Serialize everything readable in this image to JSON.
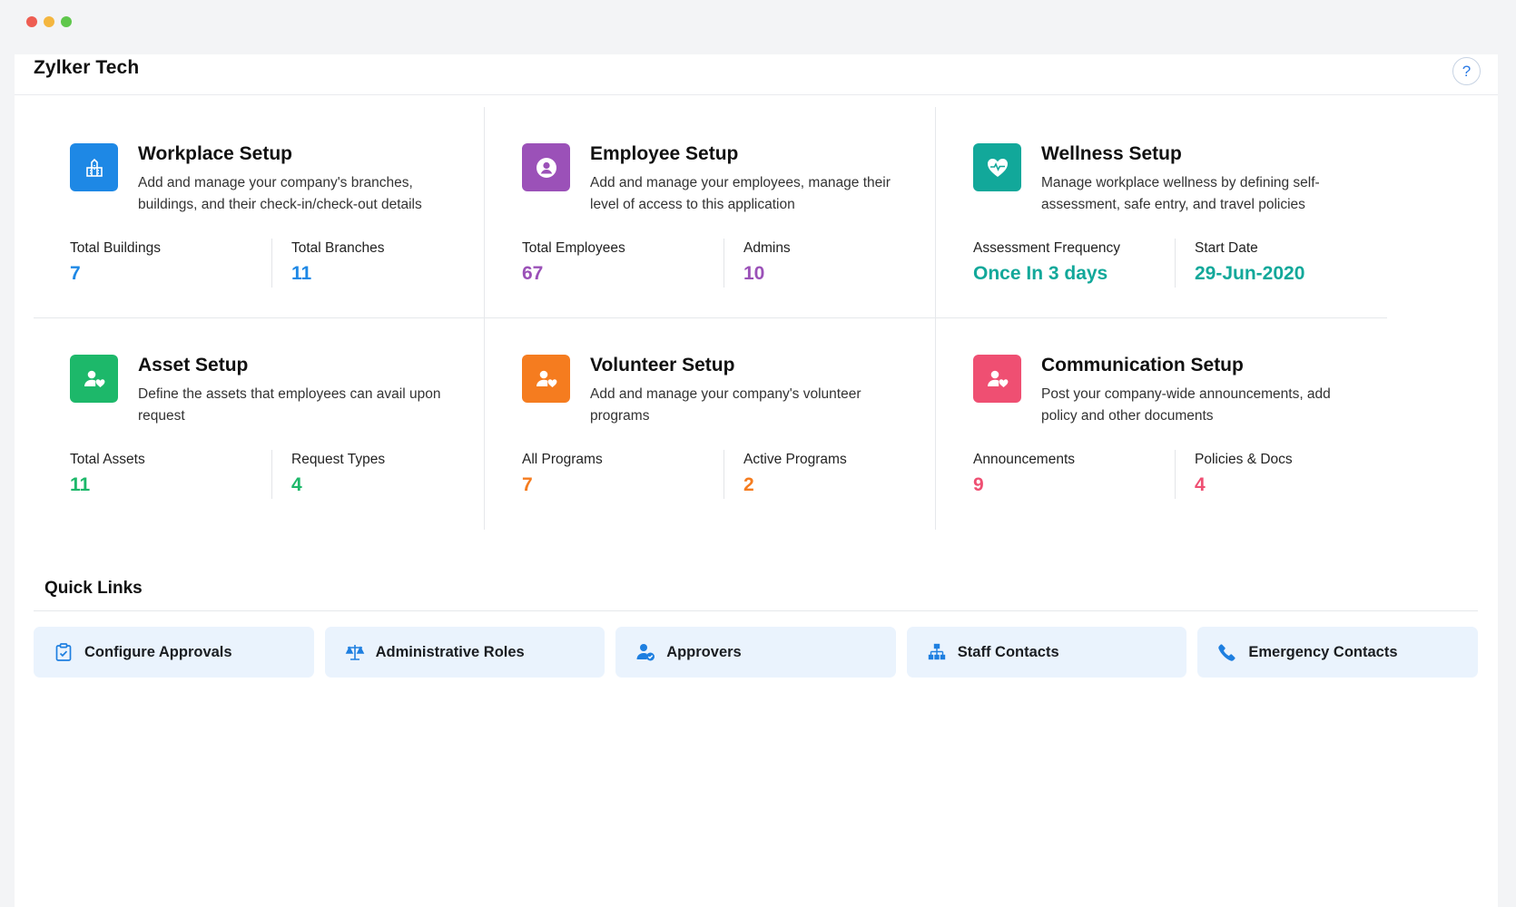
{
  "app": {
    "company_name": "Zylker Tech",
    "help_label": "?"
  },
  "cards": [
    {
      "title": "Workplace Setup",
      "description": "Add and manage your company's branches, buildings, and their check-in/check-out details",
      "icon": "building-icon",
      "color": "#1e88e5",
      "stats": [
        {
          "label": "Total Buildings",
          "value": "7"
        },
        {
          "label": "Total Branches",
          "value": "11"
        }
      ]
    },
    {
      "title": "Employee Setup",
      "description": "Add and manage your employees, manage their level of access to this application",
      "icon": "user-circle-icon",
      "color": "#9b51b8",
      "stats": [
        {
          "label": "Total Employees",
          "value": "67"
        },
        {
          "label": "Admins",
          "value": "10"
        }
      ]
    },
    {
      "title": "Wellness Setup",
      "description": "Manage workplace wellness by defining self-assessment, safe entry, and travel policies",
      "icon": "heart-pulse-icon",
      "color": "#12a89a",
      "stats": [
        {
          "label": "Assessment Frequency",
          "value": "Once In 3 days"
        },
        {
          "label": "Start Date",
          "value": "29-Jun-2020"
        }
      ]
    },
    {
      "title": "Asset Setup",
      "description": "Define the assets that employees can avail upon request",
      "icon": "user-heart-icon",
      "color": "#1db86a",
      "stats": [
        {
          "label": "Total Assets",
          "value": "11"
        },
        {
          "label": "Request Types",
          "value": "4"
        }
      ]
    },
    {
      "title": "Volunteer Setup",
      "description": "Add and manage your company's volunteer programs",
      "icon": "user-heart-icon",
      "color": "#f57c1f",
      "stats": [
        {
          "label": "All Programs",
          "value": "7"
        },
        {
          "label": "Active Programs",
          "value": "2"
        }
      ]
    },
    {
      "title": "Communication Setup",
      "description": "Post your company-wide announcements, add policy and other documents",
      "icon": "user-heart-icon",
      "color": "#ef4f72",
      "stats": [
        {
          "label": "Announcements",
          "value": "9"
        },
        {
          "label": "Policies & Docs",
          "value": "4"
        }
      ]
    }
  ],
  "quick_links": {
    "title": "Quick Links",
    "items": [
      {
        "label": "Configure Approvals",
        "icon": "clipboard-check-icon"
      },
      {
        "label": "Administrative Roles",
        "icon": "scale-icon"
      },
      {
        "label": "Approvers",
        "icon": "user-check-icon"
      },
      {
        "label": "Staff Contacts",
        "icon": "org-chart-icon"
      },
      {
        "label": "Emergency Contacts",
        "icon": "phone-icon"
      }
    ]
  },
  "colors": {
    "quick_link_icon": "#1e7fe0",
    "quick_link_bg": "#eaf3fd"
  }
}
